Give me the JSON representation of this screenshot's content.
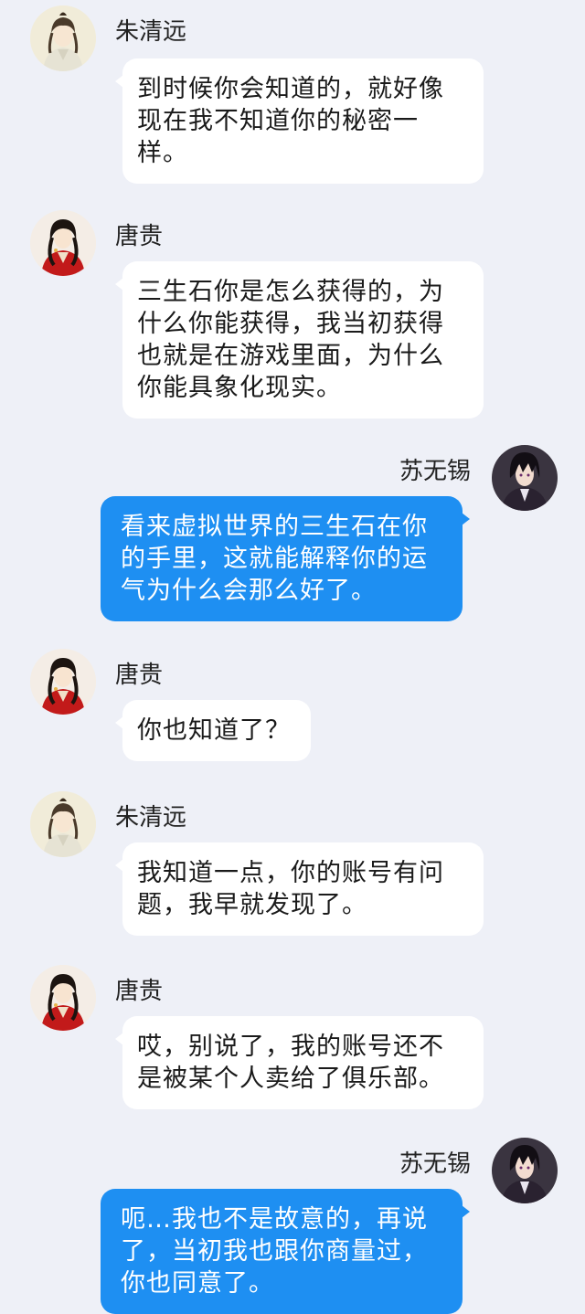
{
  "contacts": {
    "zhu": {
      "name": "朱清远",
      "avatar": "scholar-avatar-icon"
    },
    "tang": {
      "name": "唐贵",
      "avatar": "red-robe-avatar-icon"
    },
    "su": {
      "name": "苏无锡",
      "avatar": "dark-hair-avatar-icon"
    }
  },
  "colors": {
    "background": "#eef0f7",
    "incoming_bubble": "#ffffff",
    "outgoing_bubble": "#1e8ff2",
    "outgoing_text": "#ffffff"
  },
  "messages": [
    {
      "sender": "朱清远",
      "lines": [
        "到时候你会知道的，就好像",
        "现在我不知道你的秘密一",
        "样。"
      ]
    },
    {
      "sender": "唐贵",
      "lines": [
        "三生石你是怎么获得的，为",
        "什么你能获得，我当初获得",
        "也就是在游戏里面，为什么",
        "你能具象化现实。"
      ]
    },
    {
      "sender": "苏无锡",
      "lines": [
        "看来虚拟世界的三生石在你",
        "的手里，这就能解释你的运",
        "气为什么会那么好了。"
      ]
    },
    {
      "sender": "唐贵",
      "lines": [
        "你也知道了？"
      ]
    },
    {
      "sender": "朱清远",
      "lines": [
        "我知道一点，你的账号有问",
        "题，我早就发现了。"
      ]
    },
    {
      "sender": "唐贵",
      "lines": [
        "哎，别说了，我的账号还不",
        "是被某个人卖给了俱乐部。"
      ]
    },
    {
      "sender": "苏无锡",
      "lines": [
        "呃…我也不是故意的，再说",
        "了，当初我也跟你商量过，",
        "你也同意了。"
      ]
    }
  ]
}
